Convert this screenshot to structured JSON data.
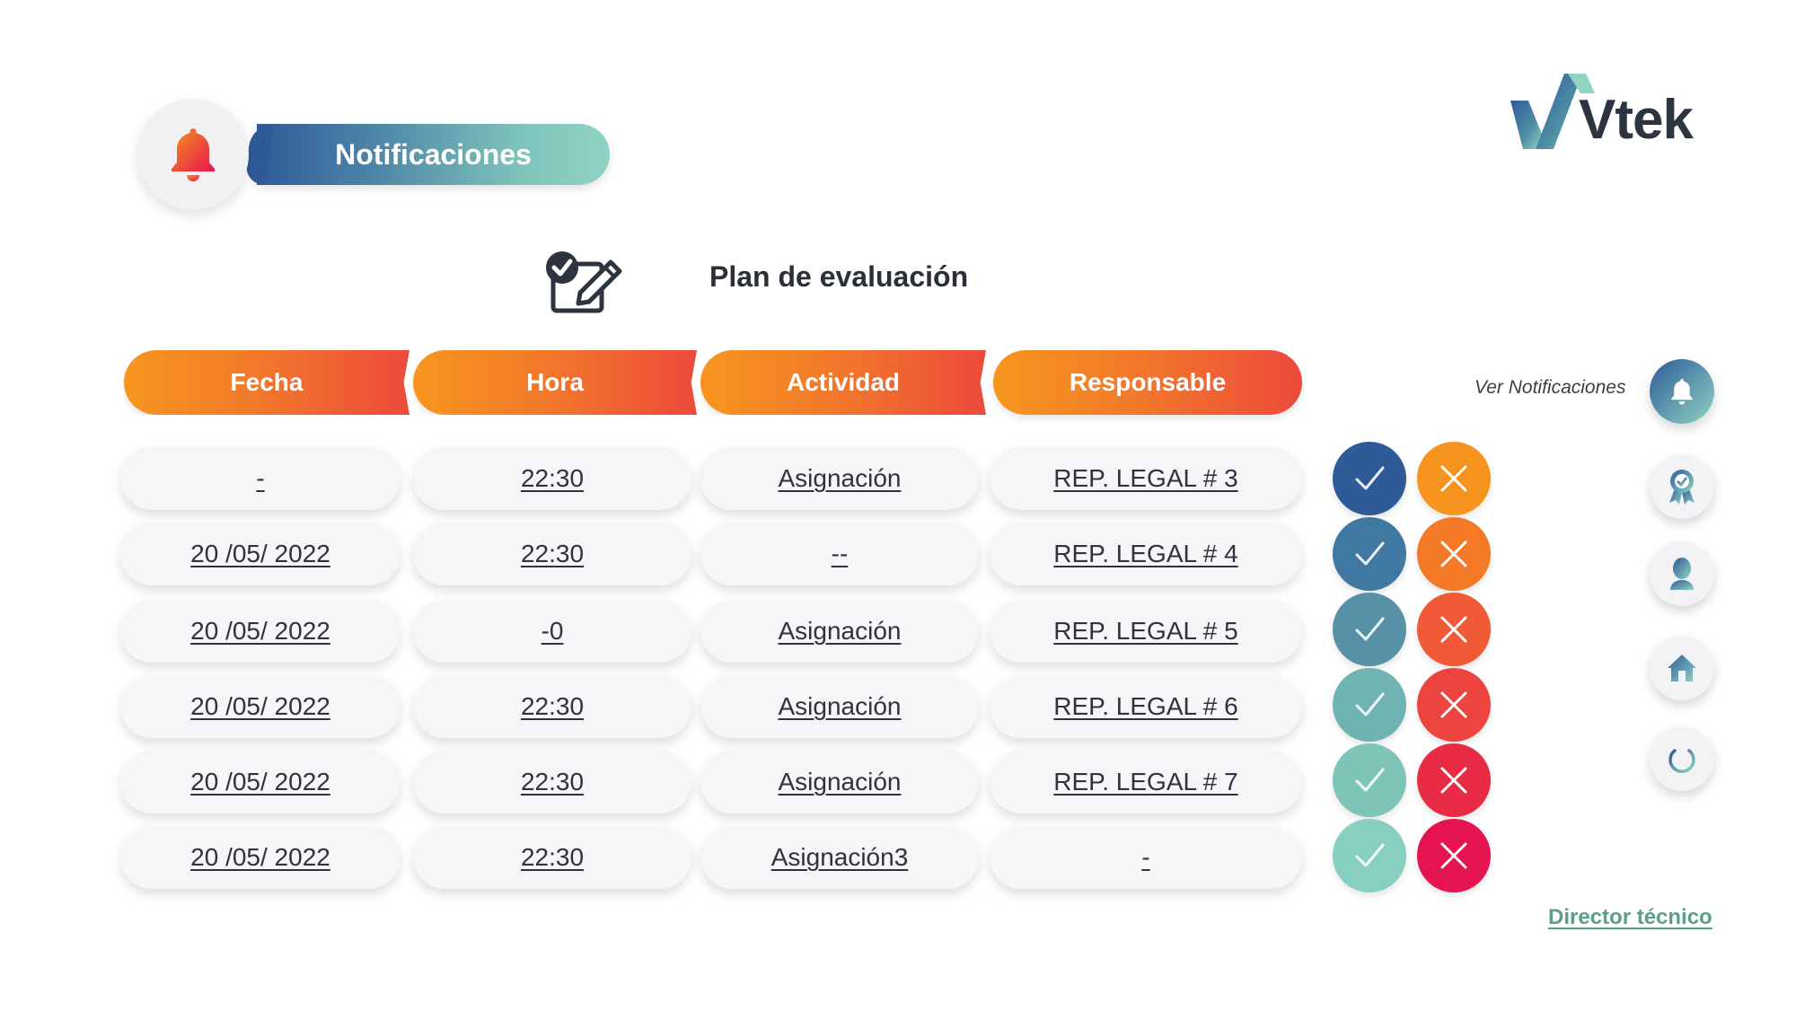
{
  "header": {
    "title": "Notificaciones",
    "bell_icon": "bell-icon",
    "logo_text": "Vtek"
  },
  "section": {
    "title": "Plan de evaluación",
    "icon": "checklist-edit-icon"
  },
  "table": {
    "columns": [
      "Fecha",
      "Hora",
      "Actividad",
      "Responsable"
    ],
    "rows": [
      {
        "fecha": "-",
        "hora": "22:30",
        "actividad": "Asignación",
        "responsable": "REP. LEGAL # 3"
      },
      {
        "fecha": "20 /05/ 2022",
        "hora": "22:30",
        "actividad": "--",
        "responsable": "REP. LEGAL # 4"
      },
      {
        "fecha": "20 /05/ 2022",
        "hora": "-0",
        "actividad": "Asignación",
        "responsable": "REP. LEGAL # 5"
      },
      {
        "fecha": "20 /05/ 2022",
        "hora": "22:30",
        "actividad": "Asignación",
        "responsable": "REP. LEGAL # 6"
      },
      {
        "fecha": "20 /05/ 2022",
        "hora": "22:30",
        "actividad": "Asignación",
        "responsable": "REP. LEGAL # 7"
      },
      {
        "fecha": "20 /05/ 2022",
        "hora": "22:30",
        "actividad": "Asignación3",
        "responsable": "-"
      }
    ],
    "approve_colors": [
      "#2f5a98",
      "#3f78a0",
      "#5691a8",
      "#6fb3b2",
      "#7ec4b9",
      "#86cfc1"
    ],
    "reject_colors": [
      "#f7941e",
      "#f47a28",
      "#f15a36",
      "#ee4440",
      "#e92c46",
      "#e5134f"
    ]
  },
  "sidebar": {
    "label": "Ver Notificaciones",
    "buttons": [
      "bell-icon",
      "award-icon",
      "user-icon",
      "home-icon",
      "power-icon"
    ]
  },
  "footer": {
    "role_link": "Director técnico"
  },
  "colors": {
    "brand_blue": "#2f5a98",
    "brand_teal": "#8fd3c3",
    "header_orange": "#f7961f",
    "header_red": "#ec4a3b",
    "link_green": "#5c9e8c"
  }
}
